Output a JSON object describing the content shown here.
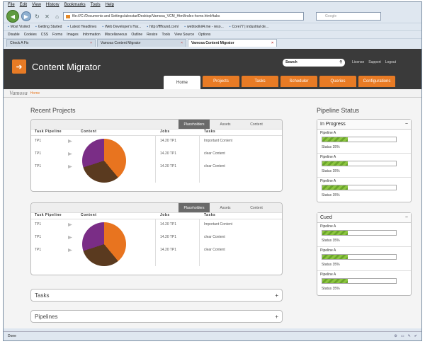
{
  "browser": {
    "menu": [
      "File",
      "Edit",
      "View",
      "History",
      "Bookmarks",
      "Tools",
      "Help"
    ],
    "url": "file:///C:/Documents and Settings/alexstar/Desktop/Vamosa_VCM_Html/index-home.html#tabs",
    "search_placeholder": "Google",
    "bookmarks": [
      "Most Visited",
      "Getting Started",
      "Latest Headlines",
      "Web Developer's Har...",
      "http://ffffound.com/",
      "webtoolkit4.me - reso...",
      "Core77 | industrial de..."
    ],
    "devtools": [
      "Disable",
      "Cookies",
      "CSS",
      "Forms",
      "Images",
      "Information",
      "Miscellaneous",
      "Outline",
      "Resize",
      "Tools",
      "View Source",
      "Options"
    ],
    "tabs": [
      {
        "label": "Check A Fix"
      },
      {
        "label": "Vamosa Content Migrator"
      },
      {
        "label": "Vamosa Content Migrator"
      }
    ],
    "status": "Done"
  },
  "app": {
    "title": "Content Migrator",
    "search_value": "Search",
    "links": [
      "License",
      "Support",
      "Logout"
    ],
    "tabs": [
      "Home",
      "Projects",
      "Tasks",
      "Scheduler",
      "Queries",
      "Configurations"
    ],
    "brand": "Vamosa",
    "crumb": "Home",
    "accent": "#e87b25"
  },
  "recent": {
    "title": "Recent Projects",
    "panel_tabs": [
      "Placeholders",
      "Assets",
      "Content"
    ],
    "columns": [
      "Task Pipeline",
      "Content",
      "Jobs",
      "Tasks"
    ],
    "panels": [
      {
        "rows": [
          {
            "pipeline": "TP1",
            "jobs": "14.20 TP1",
            "task": "Important Content"
          },
          {
            "pipeline": "TP1",
            "jobs": "14.20 TP1",
            "task": "clear Content"
          },
          {
            "pipeline": "TP1",
            "jobs": "14.20 TP1",
            "task": "clear Content"
          }
        ]
      },
      {
        "rows": [
          {
            "pipeline": "TP1",
            "jobs": "14.20 TP1",
            "task": "Important Content"
          },
          {
            "pipeline": "TP1",
            "jobs": "14.20 TP1",
            "task": "clear Content"
          },
          {
            "pipeline": "TP1",
            "jobs": "14.20 TP1",
            "task": "clear Content"
          }
        ]
      }
    ]
  },
  "accordions": [
    {
      "label": "Tasks",
      "icon": "+"
    },
    {
      "label": "Pipelines",
      "icon": "+"
    }
  ],
  "pipeline": {
    "title": "Pipeline Status",
    "groups": [
      {
        "label": "In Progress",
        "toggle": "−",
        "items": [
          {
            "name": "Pipeline A",
            "progress": 35,
            "status": "Status 35%"
          },
          {
            "name": "Pipeline A",
            "progress": 35,
            "status": "Status 35%"
          },
          {
            "name": "Pipeline A",
            "progress": 35,
            "status": "Status 35%"
          }
        ]
      },
      {
        "label": "Cued",
        "toggle": "−",
        "items": [
          {
            "name": "Pipeline A",
            "progress": 35,
            "status": "Status 35%"
          },
          {
            "name": "Pipeline A",
            "progress": 35,
            "status": "Status 35%"
          },
          {
            "name": "Pipeline A",
            "progress": 35,
            "status": "Status 35%"
          }
        ]
      }
    ]
  }
}
